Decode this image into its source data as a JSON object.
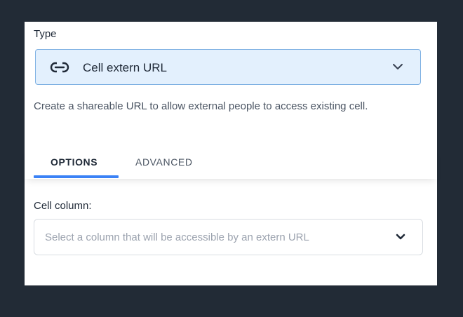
{
  "type_field": {
    "label": "Type",
    "selected_value": "Cell extern URL",
    "icon": "link-icon"
  },
  "description": "Create a shareable URL to allow external people to access existing cell.",
  "tabs": [
    {
      "label": "OPTIONS",
      "active": true
    },
    {
      "label": "ADVANCED",
      "active": false
    }
  ],
  "cell_column": {
    "label": "Cell column:",
    "placeholder": "Select a column that will be accessible by an extern URL"
  },
  "colors": {
    "background": "#222b36",
    "accent": "#3b82f6",
    "select_highlight": "#e3f0fd"
  }
}
